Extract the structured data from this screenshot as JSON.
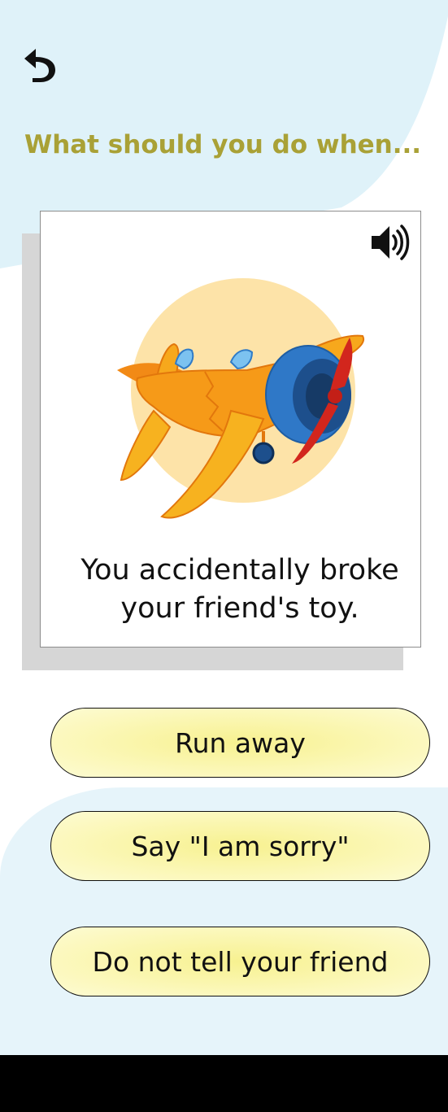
{
  "header": {
    "back_icon": "undo-arrow-icon",
    "title": "What should you do when..."
  },
  "card": {
    "speaker_icon": "speaker-icon",
    "image_icon": "toy-airplane-broken",
    "scenario_text": "You accidentally broke your friend's toy."
  },
  "options": [
    {
      "label": "Run away"
    },
    {
      "label": "Say \"I am sorry\""
    },
    {
      "label": "Do not tell your friend"
    }
  ],
  "colors": {
    "title": "#a9a136",
    "top_bg": "#dff2f9",
    "option_fill": "#f7f190"
  }
}
